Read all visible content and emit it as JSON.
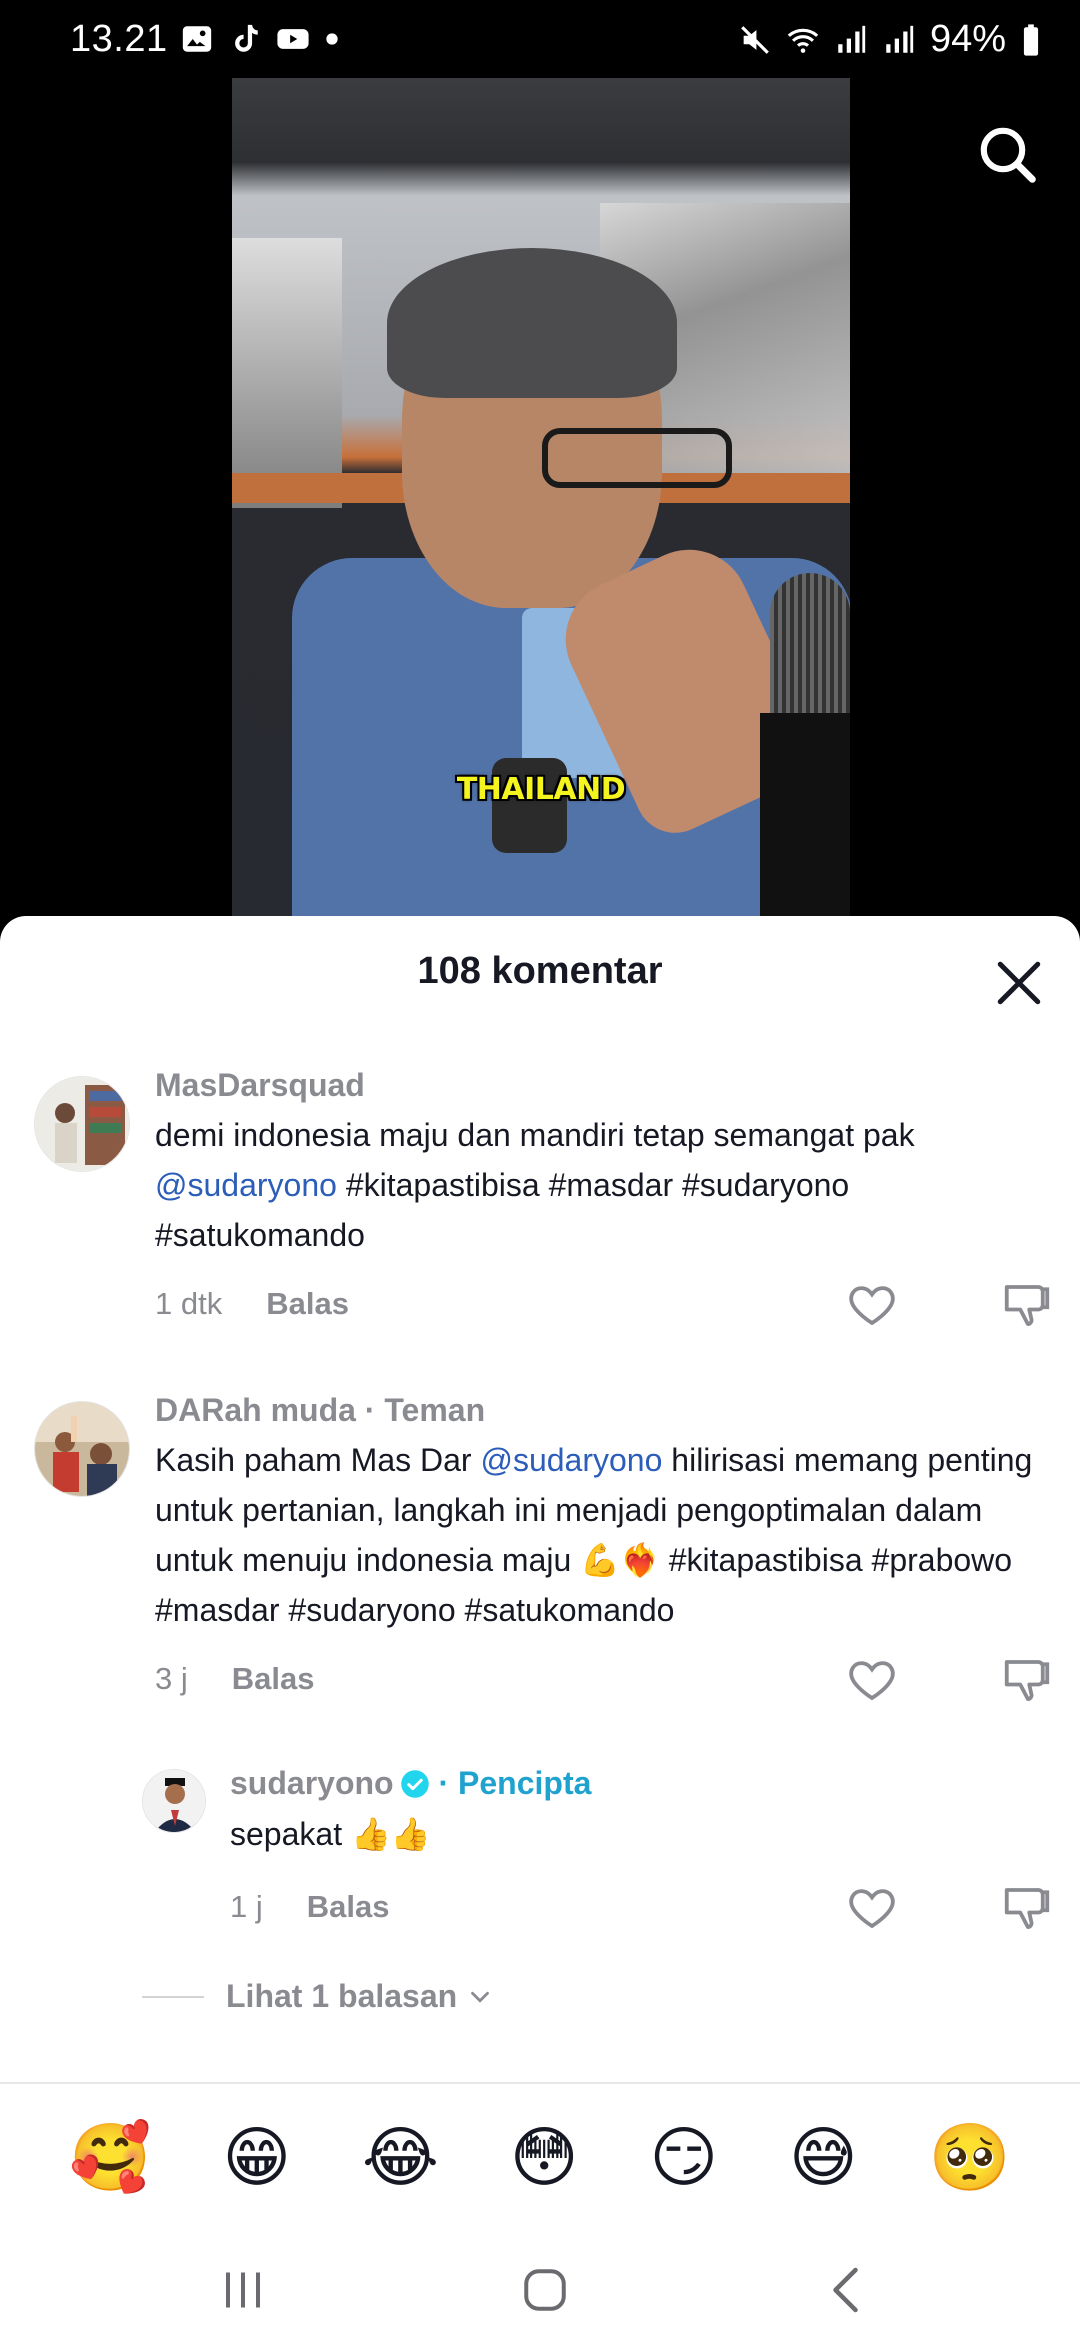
{
  "status_bar": {
    "time": "13.21",
    "battery": "94%",
    "left_icons": [
      "gallery-icon",
      "tiktok-icon",
      "youtube-icon",
      "dot-icon"
    ],
    "right_icons": [
      "mute-icon",
      "wifi-icon",
      "signal-icon",
      "signal-icon",
      "battery-icon"
    ]
  },
  "video": {
    "caption": "THAILAND"
  },
  "comments_sheet": {
    "title": "108 komentar",
    "comments": [
      {
        "username": "MasDarsquad",
        "text_before": "demi indonesia maju dan mandiri tetap semangat pak ",
        "mention": "@sudaryono",
        "text_after": " #kitapastibisa #masdar #sudaryono #satukomando",
        "time": "1 dtk",
        "reply_label": "Balas"
      },
      {
        "username": "DARah muda",
        "tag": "· Teman",
        "text_before": "Kasih paham Mas Dar ",
        "mention": "@sudaryono",
        "text_after": " hilirisasi memang penting untuk pertanian, langkah ini menjadi pengoptimalan dalam untuk menuju indonesia maju 💪❤️‍🔥 #kitapastibisa #prabowo #masdar #sudaryono #satukomando",
        "time": "3 j",
        "reply_label": "Balas"
      },
      {
        "username": "sudaryono",
        "tag": "· Pencipta",
        "text": "sepakat 👍👍",
        "time": "1 j",
        "reply_label": "Balas"
      }
    ],
    "view_replies": "Lihat 1 balasan"
  },
  "emoji_bar": [
    "🥰",
    "😁",
    "😂",
    "😳",
    "😏",
    "😅",
    "🥺"
  ],
  "nav_bar": [
    "recents-icon",
    "home-icon",
    "back-icon"
  ]
}
